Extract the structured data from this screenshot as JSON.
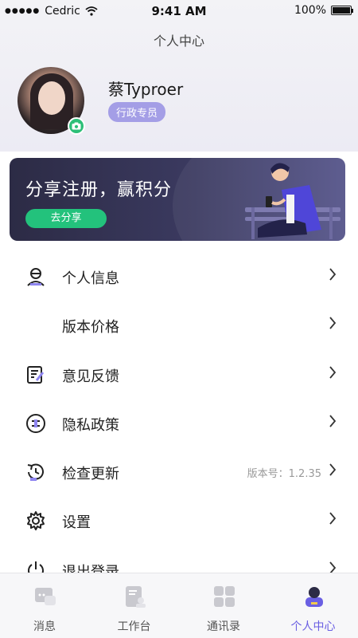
{
  "status": {
    "carrier": "Cedric",
    "time": "9:41 AM",
    "battery": "100%"
  },
  "header": {
    "title": "个人中心"
  },
  "profile": {
    "name": "蔡Typroer",
    "role": "行政专员"
  },
  "banner": {
    "title": "分享注册，赢积分",
    "button_label": "去分享"
  },
  "menu": {
    "items": [
      {
        "label": "个人信息",
        "icon": "user-icon"
      },
      {
        "label": "版本价格",
        "icon": ""
      },
      {
        "label": "意见反馈",
        "icon": "feedback-icon"
      },
      {
        "label": "隐私政策",
        "icon": "privacy-icon"
      },
      {
        "label": "检查更新",
        "icon": "update-icon",
        "extra": "版本号：1.2.35"
      },
      {
        "label": "设置",
        "icon": "gear-icon"
      },
      {
        "label": "退出登录",
        "icon": "power-icon"
      }
    ]
  },
  "tabs": [
    {
      "label": "消息",
      "icon": "message-icon",
      "active": false
    },
    {
      "label": "工作台",
      "icon": "workbench-icon",
      "active": false
    },
    {
      "label": "通讯录",
      "icon": "contacts-icon",
      "active": false
    },
    {
      "label": "个人中心",
      "icon": "profile-icon",
      "active": true
    }
  ],
  "colors": {
    "accent": "#6a5fe3",
    "role_badge": "#a49ee6",
    "share_button": "#23c27c",
    "banner_bg": "#2c2b45"
  }
}
